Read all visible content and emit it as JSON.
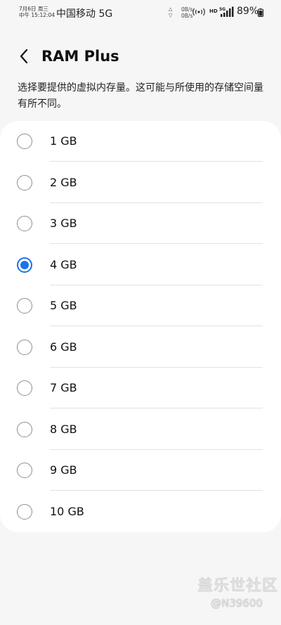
{
  "status_bar": {
    "date": "7月6日 周三",
    "time": "中午 15:12:04",
    "carrier": "中国移动 5G",
    "upload_speed": "0B/s",
    "download_speed": "0B/s",
    "hd_label": "HD",
    "network_label": "5G",
    "battery_pct": "89%",
    "battery_level": 0.89
  },
  "header": {
    "title": "RAM Plus"
  },
  "description": "选择要提供的虚拟内存量。这可能与所使用的存储空间量有所不同。",
  "options": [
    {
      "label": "1 GB",
      "selected": false
    },
    {
      "label": "2 GB",
      "selected": false
    },
    {
      "label": "3 GB",
      "selected": false
    },
    {
      "label": "4 GB",
      "selected": true
    },
    {
      "label": "5 GB",
      "selected": false
    },
    {
      "label": "6 GB",
      "selected": false
    },
    {
      "label": "7 GB",
      "selected": false
    },
    {
      "label": "8 GB",
      "selected": false
    },
    {
      "label": "9 GB",
      "selected": false
    },
    {
      "label": "10 GB",
      "selected": false
    }
  ],
  "colors": {
    "accent": "#1a73e8",
    "background": "#f6f6f6",
    "card": "#ffffff"
  },
  "watermark": {
    "brand": "盖乐世社区",
    "user": "@N39600"
  }
}
